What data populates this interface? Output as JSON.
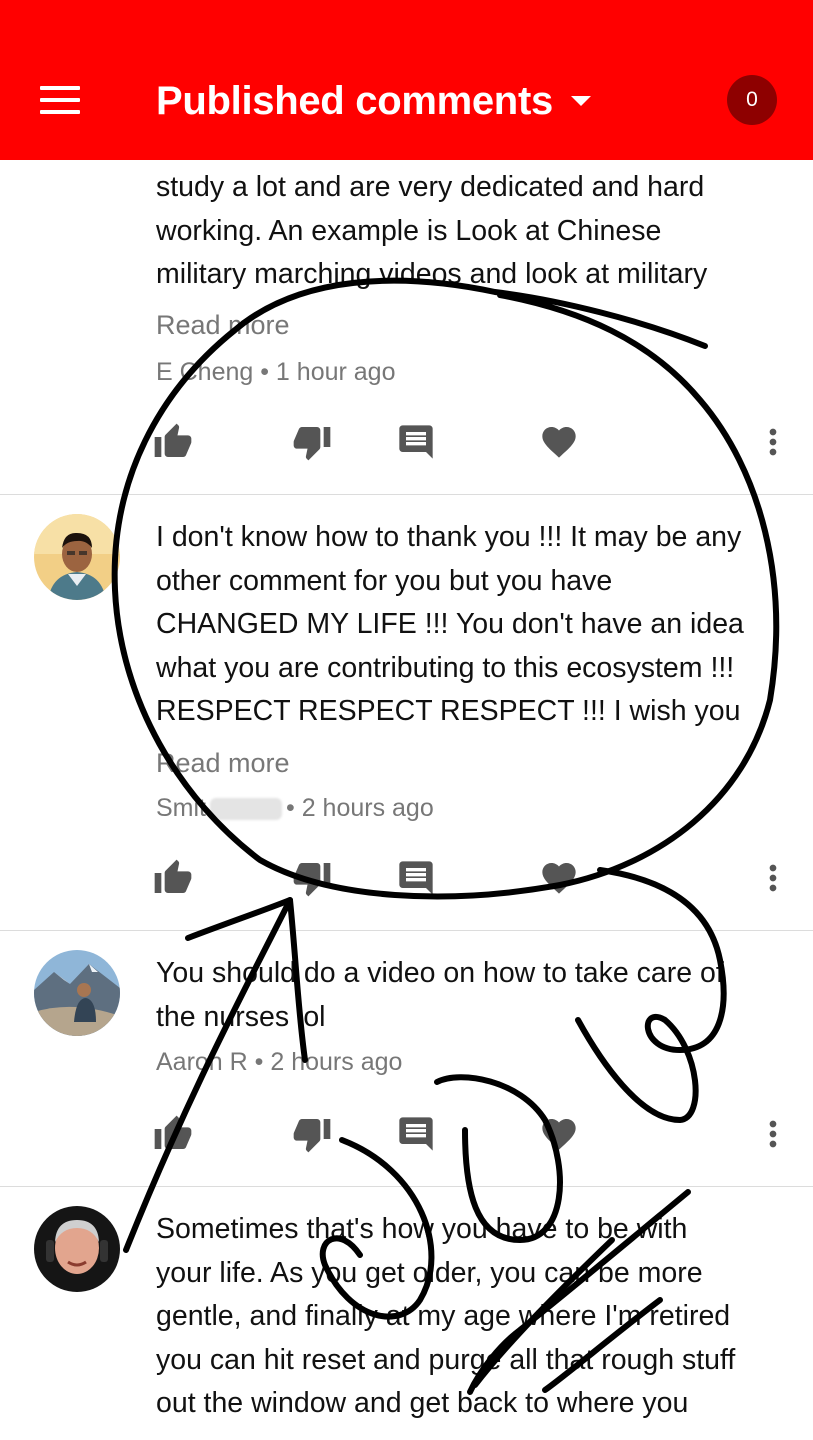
{
  "header": {
    "title": "Published comments",
    "count": "0"
  },
  "comments": [
    {
      "lines": [
        "study a lot and are very dedicated and hard",
        "working. An example is Look at Chinese",
        "military marching videos and look at military"
      ],
      "read_more": "Read more",
      "meta": "E Cheng • 1 hour ago"
    },
    {
      "lines": [
        "I don't know how to thank you !!! It may be any",
        "other comment for you but you have",
        "CHANGED MY LIFE !!! You don't have an idea",
        "what you are contributing to this ecosystem !!!",
        "RESPECT RESPECT RESPECT !!! I wish you"
      ],
      "read_more": "Read more",
      "author": "Smit",
      "meta_time": "• 2 hours ago"
    },
    {
      "lines": [
        "You should do a video on how to take care of",
        "the nurses lol"
      ],
      "meta": "Aaron R • 2 hours ago"
    },
    {
      "lines": [
        "Sometimes that's how you have to be with",
        "your life. As you get older, you can be more",
        "gentle, and finally at my age where I'm retired",
        "you can hit reset and purge all that rough stuff",
        "out the window and get back to where you"
      ]
    }
  ],
  "icons": {
    "like": "thumb-up-icon",
    "dislike": "thumb-down-icon",
    "reply": "reply-icon",
    "heart": "heart-icon",
    "more": "more-vert-icon"
  },
  "colors": {
    "header": "#ff0000",
    "badge": "#8e0000",
    "icon": "#555555",
    "meta": "#777777"
  }
}
